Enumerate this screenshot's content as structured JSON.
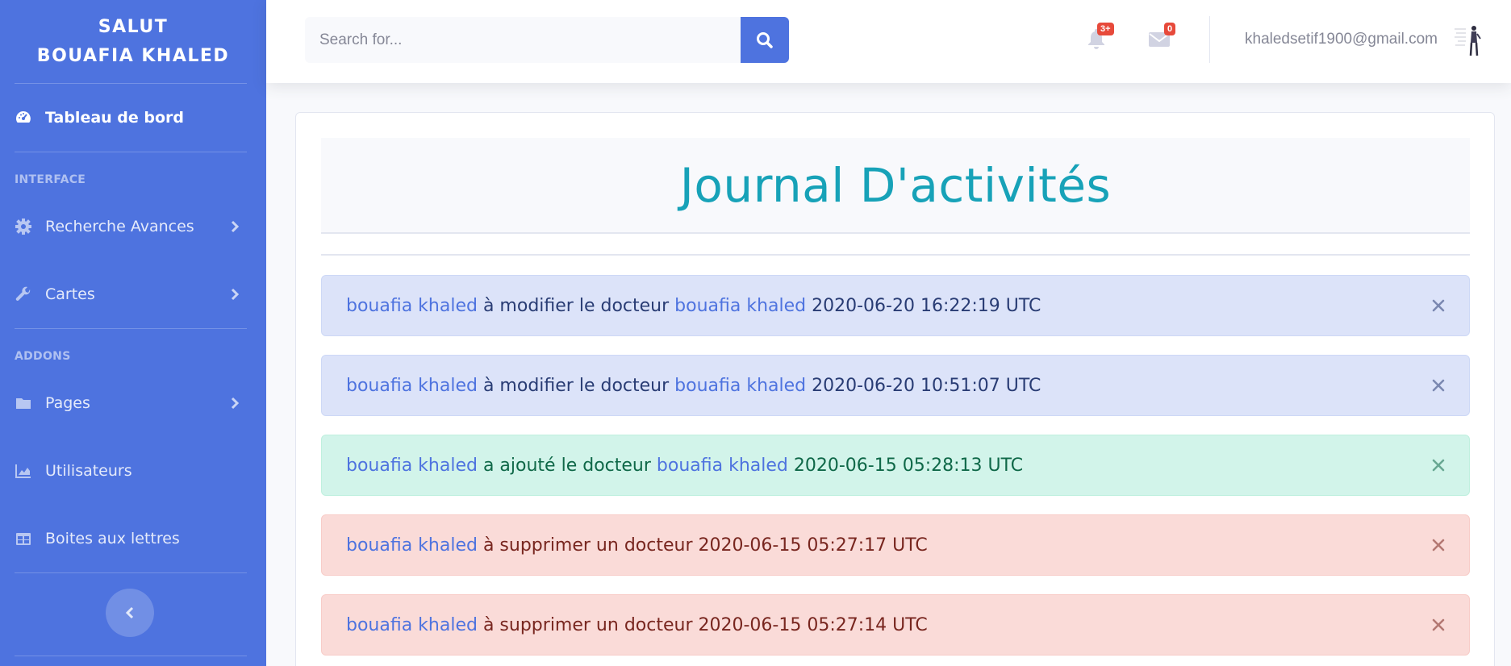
{
  "sidebar": {
    "brand_line1": "SALUT",
    "brand_line2": "BOUAFIA KHALED",
    "dashboard_label": "Tableau de bord",
    "heading_interface": "INTERFACE",
    "heading_addons": "ADDONS",
    "items": [
      {
        "label": "Recherche Avances",
        "icon": "gear-icon"
      },
      {
        "label": "Cartes",
        "icon": "wrench-icon"
      },
      {
        "label": "Pages",
        "icon": "folder-icon"
      },
      {
        "label": "Utilisateurs",
        "icon": "chart-area-icon"
      },
      {
        "label": "Boites aux lettres",
        "icon": "table-icon"
      }
    ]
  },
  "topbar": {
    "search_placeholder": "Search for...",
    "alerts_badge": "3+",
    "messages_badge": "0",
    "user_email": "khaledsetif1900@gmail.com"
  },
  "main": {
    "title": "Journal D'activités",
    "entries": [
      {
        "actor": "bouafia khaled",
        "action": " à modifier le docteur ",
        "target": "bouafia khaled",
        "time": " 2020-06-20 16:22:19 UTC",
        "type": "info"
      },
      {
        "actor": "bouafia khaled",
        "action": " à modifier le docteur ",
        "target": "bouafia khaled",
        "time": " 2020-06-20 10:51:07 UTC",
        "type": "info"
      },
      {
        "actor": "bouafia khaled",
        "action": " a ajouté le docteur ",
        "target": "bouafia khaled",
        "time": " 2020-06-15 05:28:13 UTC",
        "type": "success"
      },
      {
        "actor": "bouafia khaled",
        "action": " à supprimer un docteur 2020-06-15 05:27:17 UTC",
        "target": "",
        "time": "",
        "type": "danger"
      },
      {
        "actor": "bouafia khaled",
        "action": " à supprimer un docteur 2020-06-15 05:27:14 UTC",
        "target": "",
        "time": "",
        "type": "danger"
      }
    ]
  },
  "colors": {
    "primary": "#4e73df",
    "title": "#17a2b8",
    "badge": "#e74a3b"
  }
}
